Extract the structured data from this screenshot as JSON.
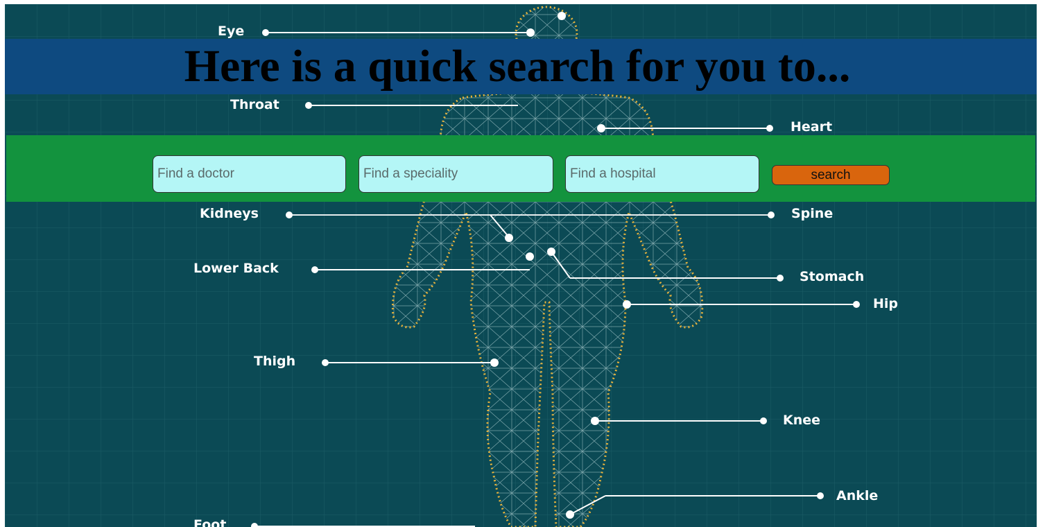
{
  "banner": {
    "title": "Here is a quick search for you to..."
  },
  "search": {
    "doctor_placeholder": "Find a doctor",
    "speciality_placeholder": "Find a speciality",
    "hospital_placeholder": "Find a hospital",
    "button_label": "search"
  },
  "body_labels": {
    "eye": "Eye",
    "throat": "Throat",
    "heart": "Heart",
    "kidneys": "Kidneys",
    "spine": "Spine",
    "lower_back": "Lower Back",
    "stomach": "Stomach",
    "hip": "Hip",
    "thigh": "Thigh",
    "knee": "Knee",
    "ankle": "Ankle",
    "foot": "Foot"
  },
  "colors": {
    "background": "#0b4a55",
    "banner": "#0e4a80",
    "search_bar": "#13933e",
    "input": "#b4f6f6",
    "button": "#d9650d",
    "outline": "#e8b33c"
  }
}
